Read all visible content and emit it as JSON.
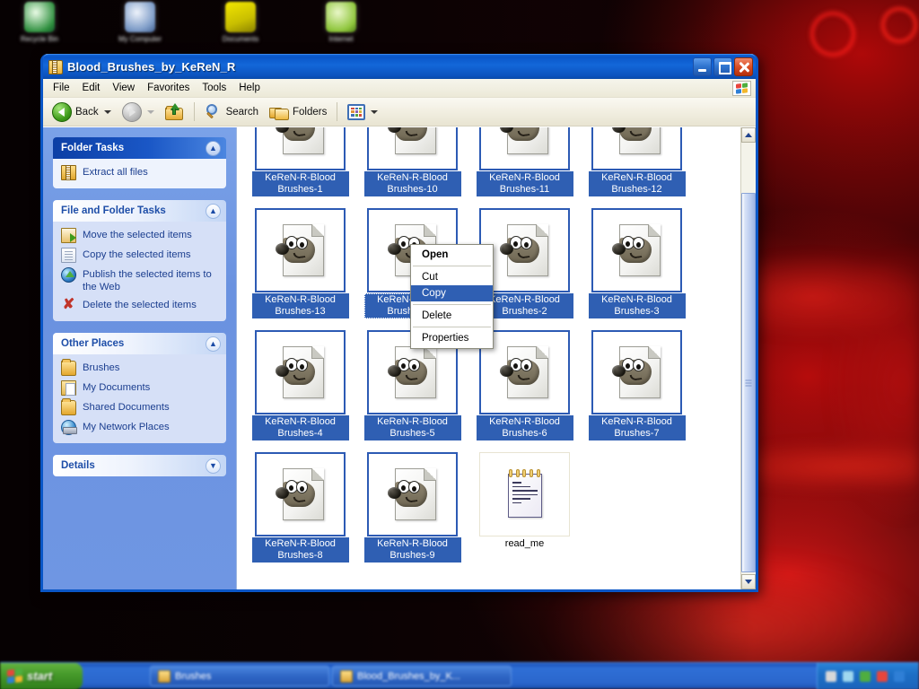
{
  "window": {
    "title": "Blood_Brushes_by_KeReN_R",
    "title_icon": "zip-folder-icon",
    "buttons": {
      "minimize": "minimize-button",
      "maximize": "maximize-button",
      "close": "close-button"
    }
  },
  "menubar": {
    "items": [
      "File",
      "Edit",
      "View",
      "Favorites",
      "Tools",
      "Help"
    ],
    "logo": "windows-flag-logo"
  },
  "toolbar": {
    "back_label": "Back",
    "search_label": "Search",
    "folders_label": "Folders",
    "icons": {
      "back": "back-arrow-icon",
      "forward": "forward-arrow-icon",
      "up": "up-folder-icon",
      "search": "magnifier-icon",
      "folders": "folders-icon",
      "views": "views-icon"
    }
  },
  "sidebar": {
    "panels": [
      {
        "title": "Folder Tasks",
        "style": "dark",
        "chevron": "collapse-chevron-up",
        "items": [
          {
            "label": "Extract all files",
            "icon": "zip-extract-icon"
          }
        ]
      },
      {
        "title": "File and Folder Tasks",
        "style": "light",
        "chevron": "collapse-chevron-up",
        "items": [
          {
            "label": "Move the selected items",
            "icon": "move-icon"
          },
          {
            "label": "Copy the selected items",
            "icon": "copy-icon"
          },
          {
            "label": "Publish the selected items to the Web",
            "icon": "publish-web-icon"
          },
          {
            "label": "Delete the selected items",
            "icon": "delete-x-icon"
          }
        ]
      },
      {
        "title": "Other Places",
        "style": "light",
        "chevron": "collapse-chevron-up",
        "items": [
          {
            "label": "Brushes",
            "icon": "folder-icon"
          },
          {
            "label": "My Documents",
            "icon": "my-documents-icon"
          },
          {
            "label": "Shared Documents",
            "icon": "folder-icon"
          },
          {
            "label": "My Network Places",
            "icon": "network-places-icon"
          }
        ]
      },
      {
        "title": "Details",
        "style": "light",
        "chevron": "expand-chevron-down",
        "items": []
      }
    ]
  },
  "files": [
    {
      "name": "KeReN-R-Blood Brushes-1",
      "icon": "gimp-brush-file-icon",
      "selected": true,
      "focused": false
    },
    {
      "name": "KeReN-R-Blood Brushes-10",
      "icon": "gimp-brush-file-icon",
      "selected": true,
      "focused": false
    },
    {
      "name": "KeReN-R-Blood Brushes-11",
      "icon": "gimp-brush-file-icon",
      "selected": true,
      "focused": false
    },
    {
      "name": "KeReN-R-Blood Brushes-12",
      "icon": "gimp-brush-file-icon",
      "selected": true,
      "focused": false
    },
    {
      "name": "KeReN-R-Blood Brushes-13",
      "icon": "gimp-brush-file-icon",
      "selected": true,
      "focused": false
    },
    {
      "name": "KeReN-R-Blood Brushes-14",
      "icon": "gimp-brush-file-icon",
      "selected": true,
      "focused": true
    },
    {
      "name": "KeReN-R-Blood Brushes-2",
      "icon": "gimp-brush-file-icon",
      "selected": true,
      "focused": false
    },
    {
      "name": "KeReN-R-Blood Brushes-3",
      "icon": "gimp-brush-file-icon",
      "selected": true,
      "focused": false
    },
    {
      "name": "KeReN-R-Blood Brushes-4",
      "icon": "gimp-brush-file-icon",
      "selected": true,
      "focused": false
    },
    {
      "name": "KeReN-R-Blood Brushes-5",
      "icon": "gimp-brush-file-icon",
      "selected": true,
      "focused": false
    },
    {
      "name": "KeReN-R-Blood Brushes-6",
      "icon": "gimp-brush-file-icon",
      "selected": true,
      "focused": false
    },
    {
      "name": "KeReN-R-Blood Brushes-7",
      "icon": "gimp-brush-file-icon",
      "selected": true,
      "focused": false
    },
    {
      "name": "KeReN-R-Blood Brushes-8",
      "icon": "gimp-brush-file-icon",
      "selected": true,
      "focused": false
    },
    {
      "name": "KeReN-R-Blood Brushes-9",
      "icon": "gimp-brush-file-icon",
      "selected": true,
      "focused": false
    },
    {
      "name": "read_me",
      "icon": "notepad-file-icon",
      "selected": false,
      "focused": false
    }
  ],
  "context_menu": {
    "items": [
      {
        "label": "Open",
        "bold": true,
        "highlighted": false
      },
      {
        "separator": true
      },
      {
        "label": "Cut",
        "bold": false,
        "highlighted": false
      },
      {
        "label": "Copy",
        "bold": false,
        "highlighted": true
      },
      {
        "separator": true
      },
      {
        "label": "Delete",
        "bold": false,
        "highlighted": false
      },
      {
        "separator": true
      },
      {
        "label": "Properties",
        "bold": false,
        "highlighted": false
      }
    ]
  },
  "desktop": {
    "icons": [
      {
        "label": "Recycle Bin"
      },
      {
        "label": "My Computer"
      },
      {
        "label": "Documents"
      },
      {
        "label": "Internet"
      }
    ]
  },
  "taskbar": {
    "start_label": "start",
    "tasks": [
      {
        "label": "Brushes"
      },
      {
        "label": "Blood_Brushes_by_K..."
      }
    ],
    "clock": ""
  },
  "colors": {
    "title_blue": "#0a56c8",
    "selection_blue": "#2f5fb3",
    "sidebar_blue": "#6f96e3",
    "panel_body": "#eef3fd",
    "close_red": "#dc4f25",
    "wallpaper_red": "#b00808"
  }
}
